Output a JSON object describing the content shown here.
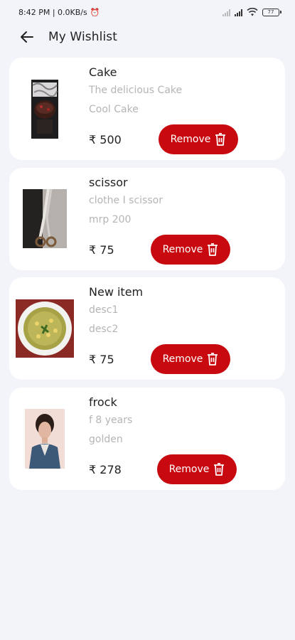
{
  "status_bar": {
    "time_network": "8:42 PM | 0.0KB/s",
    "battery": "77"
  },
  "header": {
    "title": "My Wishlist"
  },
  "wishlist": {
    "items": [
      {
        "title": "Cake",
        "desc1": "The delicious Cake",
        "desc2": "Cool Cake",
        "price": "₹ 500",
        "remove_label": "Remove"
      },
      {
        "title": "scissor",
        "desc1": "clothe I scissor",
        "desc2": "mrp 200",
        "price": "₹ 75",
        "remove_label": "Remove"
      },
      {
        "title": "New item",
        "desc1": "desc1",
        "desc2": "desc2",
        "price": "₹ 75",
        "remove_label": "Remove"
      },
      {
        "title": "frock",
        "desc1": "f 8 years",
        "desc2": "golden",
        "price": "₹ 278",
        "remove_label": "Remove"
      }
    ]
  },
  "colors": {
    "remove_button": "#c8090f",
    "background": "#f3f4f9",
    "card": "#ffffff"
  },
  "icons": {
    "back": "arrow-left-icon",
    "remove": "trash-icon",
    "alarm": "alarm-clock-icon",
    "signal": "signal-icon",
    "wifi": "wifi-icon",
    "battery": "battery-icon"
  }
}
